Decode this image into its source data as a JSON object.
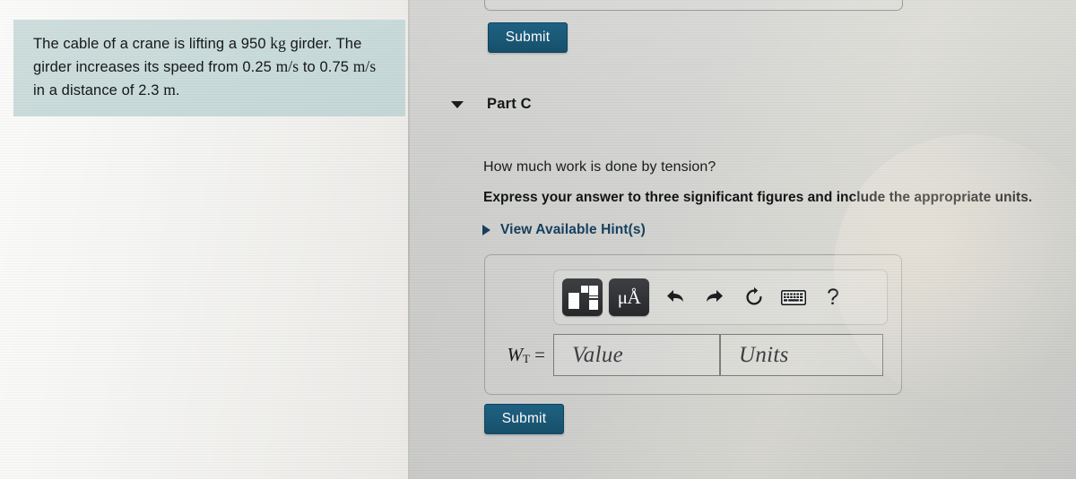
{
  "problem": {
    "sentence_1_a": "The cable of a crane is lifting a 950 ",
    "sentence_1_unit": "kg",
    "sentence_1_b": " girder. The",
    "sentence_2_a": "girder increases its speed from 0.25 ",
    "sentence_2_unit": "m/s",
    "sentence_2_b": " to",
    "sentence_3_a": "0.75 ",
    "sentence_3_unit": "m/s",
    "sentence_3_b": " in a distance of 2.3 ",
    "sentence_3_unit2": "m",
    "sentence_3_c": "."
  },
  "top_section": {
    "submit_label": "Submit"
  },
  "part": {
    "title": "Part C",
    "collapse_icon": "triangle-down",
    "question": "How much work is done by tension?",
    "instruction": "Express your answer to three significant figures and include the appropriate units.",
    "hint_label": "View Available Hint(s)",
    "hint_icon": "triangle-right"
  },
  "answer_widget": {
    "toolbar": {
      "template_button": "math-template",
      "units_button": "μÅ",
      "undo": "undo-arrow",
      "redo": "redo-arrow",
      "reset": "reset-circle",
      "keyboard": "keyboard",
      "help": "?"
    },
    "variable_label": "W",
    "variable_subscript": "T",
    "equals": " =",
    "value_placeholder": "Value",
    "units_placeholder": "Units",
    "value_current": "",
    "units_current": "",
    "submit_label": "Submit"
  },
  "colors": {
    "submit_button": "#1a5875",
    "hint_link": "#17405f",
    "problem_box": "#c9dbda",
    "toolbar_dark_button": "#303235",
    "content_panel": "#cfd0cd"
  }
}
